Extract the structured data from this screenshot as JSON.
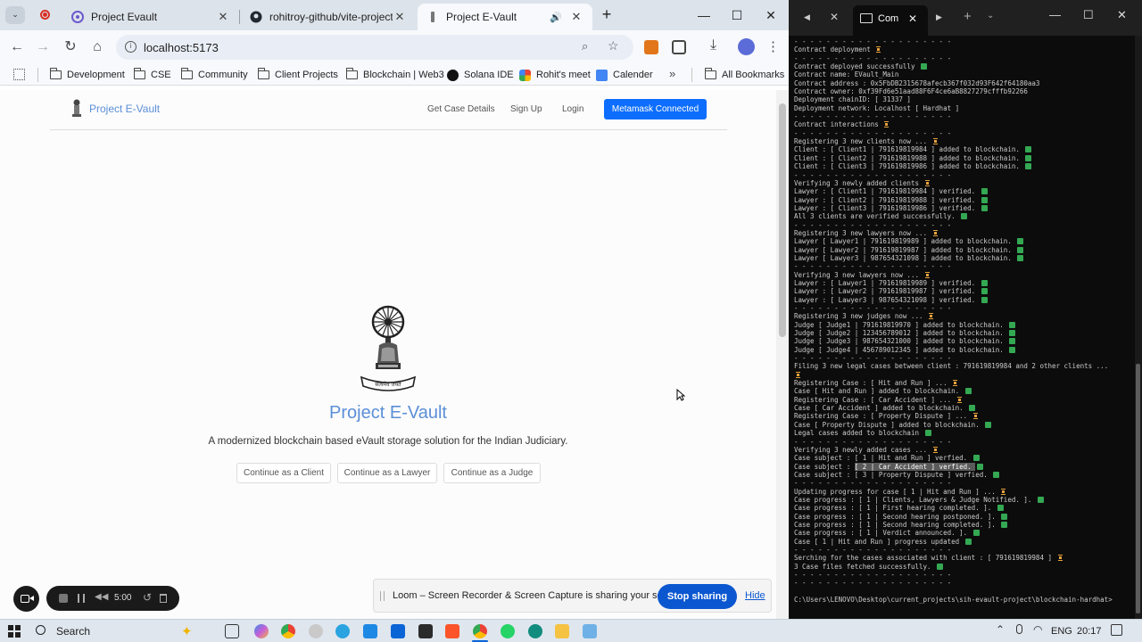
{
  "browser": {
    "tabs": [
      {
        "title": "Project Evault",
        "active": false
      },
      {
        "title": "rohitroy-github/vite-project-ev",
        "active": false
      },
      {
        "title": "Project E-Vault",
        "active": true
      }
    ],
    "url": "localhost:5173",
    "bookmarks": [
      "Development",
      "CSE",
      "Community",
      "Client Projects",
      "Blockchain | Web3",
      "Solana IDE",
      "Rohit's meet",
      "Calender"
    ],
    "all_bookmarks": "All Bookmarks"
  },
  "site": {
    "brand": "Project E-Vault",
    "nav": {
      "case_details": "Get Case Details",
      "signup": "Sign Up",
      "login": "Login",
      "metamask": "Metamask Connected"
    },
    "emblem_motto": "सत्यमेव जयते",
    "title": "Project E-Vault",
    "subtitle": "A modernized blockchain based eVault storage solution for the Indian Judiciary.",
    "buttons": {
      "client": "Continue as a Client",
      "lawyer": "Continue as a Lawyer",
      "judge": "Continue as a Judge"
    }
  },
  "recorder": {
    "time": "5:00"
  },
  "share": {
    "text": "Loom – Screen Recorder & Screen Capture is sharing your screen.",
    "stop": "Stop sharing",
    "hide": "Hide"
  },
  "terminal": {
    "tab_title": "Com",
    "lines": [
      {
        "t": "- - - - - - - - - - - - - - - - - - - -"
      },
      {
        "t": "Contract deployment ",
        "i": "hg"
      },
      {
        "t": "- - - - - - - - - - - - - - - - - - - -"
      },
      {
        "t": "Contract deployed successfully ",
        "i": "ok"
      },
      {
        "t": "Contract name: EVault_Main"
      },
      {
        "t": "Contract address : 0x5FbDB2315678afecb367f032d93F642f64180aa3"
      },
      {
        "t": "Contract owner: 0xf39Fd6e51aad88F6F4ce6aB8827279cfffb92266"
      },
      {
        "t": "Deployment chainID: [ 31337 ]"
      },
      {
        "t": "Deployment network: Localhost [ Hardhat ]"
      },
      {
        "t": "- - - - - - - - - - - - - - - - - - - -"
      },
      {
        "t": "Contract interactions ",
        "i": "hg"
      },
      {
        "t": "- - - - - - - - - - - - - - - - - - - -"
      },
      {
        "t": "Registering 3 new clients now ... ",
        "i": "hg"
      },
      {
        "t": "Client : [ Client1 | 791619819984 ] added to blockchain. ",
        "i": "ok"
      },
      {
        "t": "Client : [ Client2 | 791619819988 ] added to blockchain. ",
        "i": "ok"
      },
      {
        "t": "Client : [ Client3 | 791619819986 ] added to blockchain. ",
        "i": "ok"
      },
      {
        "t": "- - - - - - - - - - - - - - - - - - - -"
      },
      {
        "t": "Verifying 3 newly added clients ",
        "i": "hg"
      },
      {
        "t": "Lawyer : [ Client1 | 791619819984 ] verified. ",
        "i": "ok"
      },
      {
        "t": "Lawyer : [ Client2 | 791619819988 ] verified. ",
        "i": "ok"
      },
      {
        "t": "Lawyer : [ Client3 | 791619819986 ] verified. ",
        "i": "ok"
      },
      {
        "t": "All 3 clients are verified successfully. ",
        "i": "ok"
      },
      {
        "t": "- - - - - - - - - - - - - - - - - - - -"
      },
      {
        "t": "Registering 3 new lawyers now ... ",
        "i": "hg"
      },
      {
        "t": "Lawyer [ Lawyer1 | 791619819989 ] added to blockchain. ",
        "i": "ok"
      },
      {
        "t": "Lawyer [ Lawyer2 | 791619819987 ] added to blockchain. ",
        "i": "ok"
      },
      {
        "t": "Lawyer [ Lawyer3 | 987654321098 ] added to blockchain. ",
        "i": "ok"
      },
      {
        "t": "- - - - - - - - - - - - - - - - - - - -"
      },
      {
        "t": "Verifying 3 new lawyers now ... ",
        "i": "hg"
      },
      {
        "t": "Lawyer : [ Lawyer1 | 791619819989 ] verified. ",
        "i": "ok"
      },
      {
        "t": "Lawyer : [ Lawyer2 | 791619819987 ] verified. ",
        "i": "ok"
      },
      {
        "t": "Lawyer : [ Lawyer3 | 987654321098 ] verified. ",
        "i": "ok"
      },
      {
        "t": "- - - - - - - - - - - - - - - - - - - -"
      },
      {
        "t": "Registering 3 new judges now ... ",
        "i": "hg"
      },
      {
        "t": "Judge [ Judge1 | 791619819970 ] added to blockchain. ",
        "i": "ok"
      },
      {
        "t": "Judge [ Judge2 | 123456789012 ] added to blockchain. ",
        "i": "ok"
      },
      {
        "t": "Judge [ Judge3 | 987654321000 ] added to blockchain. ",
        "i": "ok"
      },
      {
        "t": "Judge [ Judge4 | 456789012345 ] added to blockchain. ",
        "i": "ok"
      },
      {
        "t": "- - - - - - - - - - - - - - - - - - - -"
      },
      {
        "t": "Filing 3 new legal cases between client : 791619819984 and 2 other clients ..."
      },
      {
        "t": "",
        "i": "hg"
      },
      {
        "t": "Registering Case : [ Hit and Run ] ... ",
        "i": "hg"
      },
      {
        "t": "Case [ Hit and Run ] added to blockchain. ",
        "i": "ok"
      },
      {
        "t": "Registering Case : [ Car Accident ] ... ",
        "i": "hg"
      },
      {
        "t": "Case [ Car Accident ] added to blockchain. ",
        "i": "ok"
      },
      {
        "t": "Registering Case : [ Property Dispute ] ... ",
        "i": "hg"
      },
      {
        "t": "Case [ Property Dispute ] added to blockchain. ",
        "i": "ok"
      },
      {
        "t": "Legal cases added to blockchain ",
        "i": "ok"
      },
      {
        "t": "- - - - - - - - - - - - - - - - - - - -"
      },
      {
        "t": "Verifying 3 newly added cases ... ",
        "i": "hg"
      },
      {
        "t": "Case subject : [ 1 | Hit and Run ] verfied. ",
        "i": "ok"
      },
      {
        "t": "Case subject : ",
        "sel": "[ 2 | Car Accident ] verfied. ",
        "i": "ok"
      },
      {
        "t": "Case subject : [ 3 | Property Dispute ] verfied. ",
        "i": "ok"
      },
      {
        "t": "- - - - - - - - - - - - - - - - - - - -"
      },
      {
        "t": "Updating progress for case [ 1 | Hit and Run ] ... ",
        "i": "hg"
      },
      {
        "t": "Case progress : [ 1 | Clients, Lawyers & Judge Notified. ]. ",
        "i": "ok"
      },
      {
        "t": "Case progress : [ 1 | First hearing completed. ]. ",
        "i": "ok"
      },
      {
        "t": "Case progress : [ 1 | Second hearing postponed. ]. ",
        "i": "ok"
      },
      {
        "t": "Case progress : [ 1 | Second hearing completed. ]. ",
        "i": "ok"
      },
      {
        "t": "Case progress : [ 1 | Verdict announced. ]. ",
        "i": "ok"
      },
      {
        "t": "Case [ 1 | Hit and Run ] progress updated ",
        "i": "ok"
      },
      {
        "t": "- - - - - - - - - - - - - - - - - - - -"
      },
      {
        "t": "Serching for the cases associated with client : [ 791619819984 ] ",
        "i": "hg"
      },
      {
        "t": "3 Case files fetched successfully. ",
        "i": "ok"
      },
      {
        "t": "- - - - - - - - - - - - - - - - - - - -"
      },
      {
        "t": "- - - - - - - - - - - - - - - - - - - -"
      },
      {
        "t": ""
      },
      {
        "t": "C:\\Users\\LENOVO\\Desktop\\current_projects\\sih-evault-project\\blockchain-hardhat>"
      }
    ]
  },
  "taskbar": {
    "search": "Search",
    "lang": "ENG",
    "time": "20:17"
  }
}
